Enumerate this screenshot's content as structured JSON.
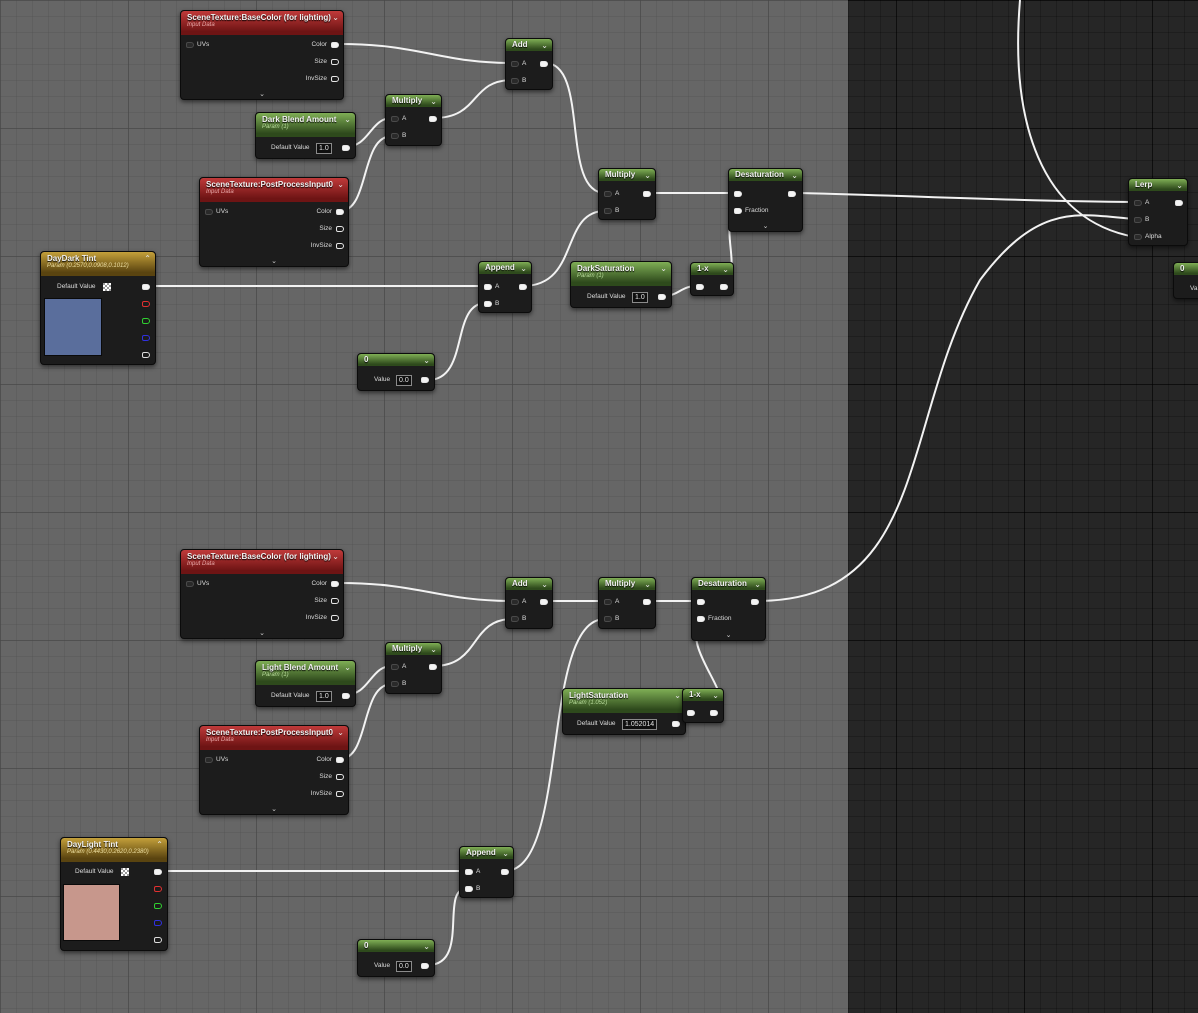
{
  "nodes": {
    "scene_basecolor_top": {
      "title": "SceneTexture:BaseColor (for lighting)",
      "subtitle": "Input Data",
      "inputs": [
        "UVs"
      ],
      "outputs": [
        "Color",
        "Size",
        "InvSize"
      ]
    },
    "scene_pp_top": {
      "title": "SceneTexture:PostProcessInput0",
      "subtitle": "Input Data",
      "inputs": [
        "UVs"
      ],
      "outputs": [
        "Color",
        "Size",
        "InvSize"
      ]
    },
    "dark_blend": {
      "title": "Dark Blend Amount",
      "subtitle": "Param (1)",
      "field_label": "Default Value",
      "value": "1.0"
    },
    "multiply_top_a": {
      "title": "Multiply",
      "pins": [
        "A",
        "B"
      ]
    },
    "add_top": {
      "title": "Add",
      "pins": [
        "A",
        "B"
      ]
    },
    "multiply_top_b": {
      "title": "Multiply",
      "pins": [
        "A",
        "B"
      ]
    },
    "desaturation_top": {
      "title": "Desaturation",
      "fraction": "Fraction"
    },
    "daydark_tint": {
      "title": "DayDark Tint",
      "subtitle": "Param (0.2570,0.0908,0.1012)",
      "field_label": "Default Value",
      "color": "#5a6e9c"
    },
    "append_top": {
      "title": "Append",
      "pins": [
        "A",
        "B"
      ]
    },
    "dark_saturation": {
      "title": "DarkSaturation",
      "subtitle": "Param (1)",
      "field_label": "Default Value",
      "value": "1.0"
    },
    "oneminus_top": {
      "title": "1-x"
    },
    "const_top": {
      "title": "0",
      "field_label": "Value",
      "value": "0.0"
    },
    "lerp": {
      "title": "Lerp",
      "pins": [
        "A",
        "B",
        "Alpha"
      ]
    },
    "edge_const": {
      "title": "0",
      "field_label": "Va"
    },
    "scene_basecolor_bot": {
      "title": "SceneTexture:BaseColor (for lighting)",
      "subtitle": "Input Data",
      "inputs": [
        "UVs"
      ],
      "outputs": [
        "Color",
        "Size",
        "InvSize"
      ]
    },
    "add_bot": {
      "title": "Add",
      "pins": [
        "A",
        "B"
      ]
    },
    "multiply_bot_b": {
      "title": "Multiply",
      "pins": [
        "A",
        "B"
      ]
    },
    "desaturation_bot": {
      "title": "Desaturation",
      "fraction": "Fraction"
    },
    "light_blend": {
      "title": "Light Blend Amount",
      "subtitle": "Param (1)",
      "field_label": "Default Value",
      "value": "1.0"
    },
    "multiply_bot_a": {
      "title": "Multiply",
      "pins": [
        "A",
        "B"
      ]
    },
    "scene_pp_bot": {
      "title": "SceneTexture:PostProcessInput0",
      "subtitle": "Input Data",
      "inputs": [
        "UVs"
      ],
      "outputs": [
        "Color",
        "Size",
        "InvSize"
      ]
    },
    "light_saturation": {
      "title": "LightSaturation",
      "subtitle": "Param (1.052)",
      "field_label": "Default Value",
      "value": "1.052014"
    },
    "oneminus_bot": {
      "title": "1-x"
    },
    "daylight_tint": {
      "title": "DayLight Tint",
      "subtitle": "Param (0.4430,0.2620,0.2380)",
      "field_label": "Default Value",
      "color": "#c7978c"
    },
    "append_bot": {
      "title": "Append",
      "pins": [
        "A",
        "B"
      ]
    },
    "const_bot": {
      "title": "0",
      "field_label": "Value",
      "value": "0.0"
    }
  },
  "icons": {
    "chevron": "chevron-down-icon",
    "pin": "pin-icon",
    "checker": "checker-icon"
  },
  "colors": {
    "wire": "#f2f2f2",
    "texture_header": "#8a2222",
    "param_header": "#4e7a32",
    "tint_header": "#a07f24"
  }
}
